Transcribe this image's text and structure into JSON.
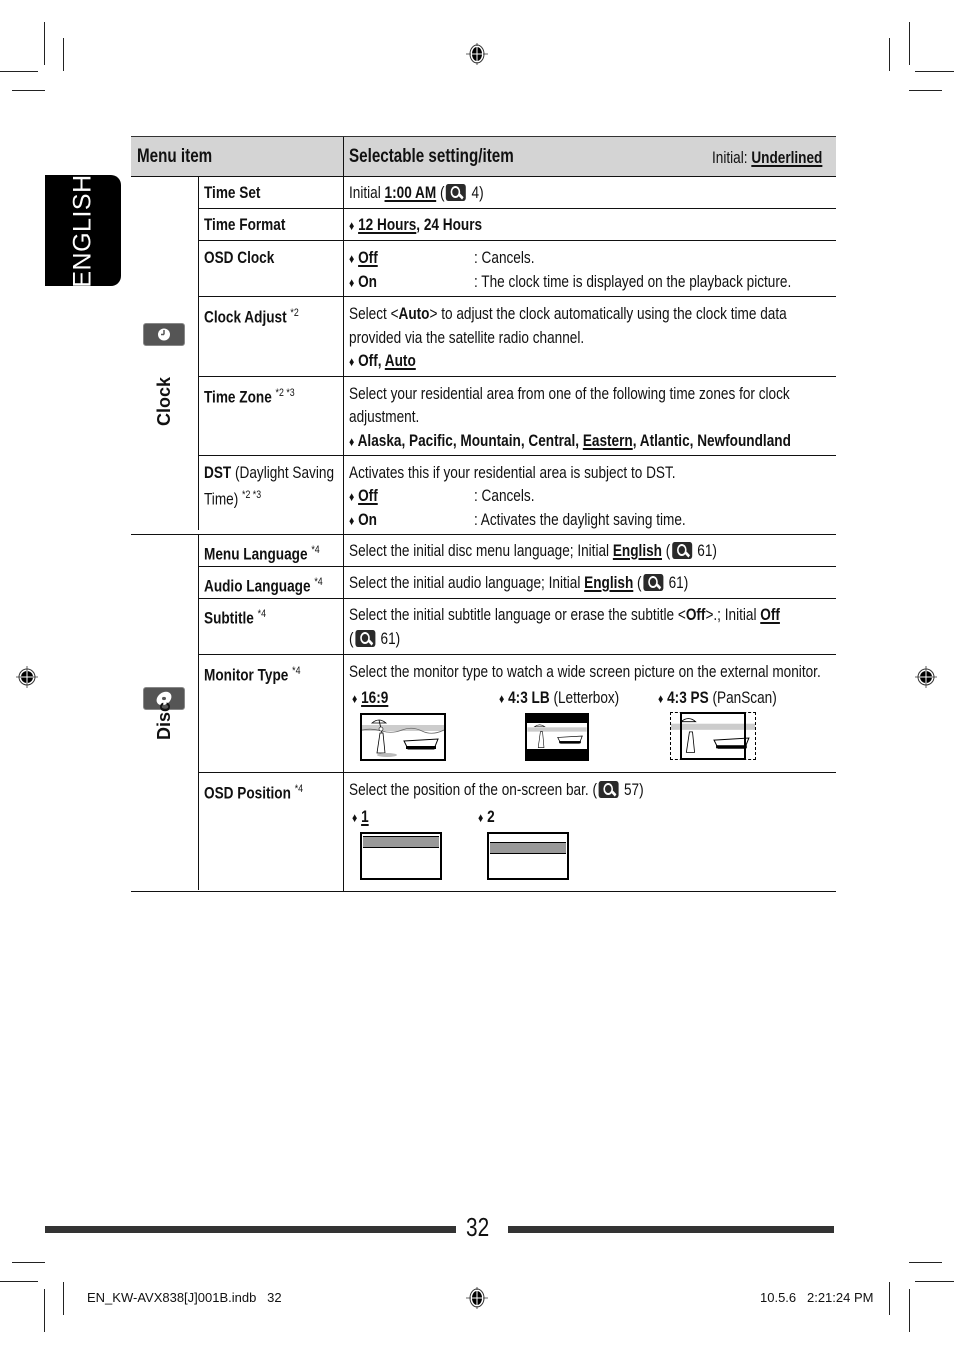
{
  "language_tab": "ENGLISH",
  "header": {
    "menu_item": "Menu item",
    "selectable": "Selectable setting/item",
    "initial_label": "Initial:",
    "initial_value": "Underlined"
  },
  "categories": {
    "clock": "Clock",
    "disc": "Disc"
  },
  "rows": {
    "time_set": {
      "name": "Time Set",
      "prefix": "Initial",
      "value": "1:00 AM",
      "ref_open": "(",
      "ref_page": "4)"
    },
    "time_format": {
      "name": "Time Format",
      "opt1": "12 Hours",
      "opt_rest": ", 24 Hours"
    },
    "osd_clock": {
      "name": "OSD Clock",
      "opt1": "Off",
      "desc1": ":  Cancels.",
      "opt2": "On",
      "desc2": ":  The clock time is displayed on the playback picture."
    },
    "clock_adjust": {
      "name": "Clock Adjust",
      "sup": "*2",
      "line1_a": "Select <",
      "line1_b": "Auto",
      "line1_c": "> to adjust the clock automatically using the clock time data",
      "line2": "provided via the satellite radio channel.",
      "opt1": "Off, ",
      "opt2": "Auto"
    },
    "time_zone": {
      "name": "Time Zone",
      "sup": "*2 *3",
      "line1": "Select your residential area from one of the following time zones for clock",
      "line2": "adjustment.",
      "opts_a": "Alaska, Pacific, Mountain, Central, ",
      "opts_u": "Eastern",
      "opts_b": ", Atlantic, Newfoundland"
    },
    "dst": {
      "name_b": "DST",
      "name_rest": " (Daylight Saving",
      "name_line2": "Time)",
      "sup": "*2 *3",
      "line1": "Activates this if your residential area is subject to DST.",
      "opt1": "Off",
      "desc1": ":  Cancels.",
      "opt2": "On",
      "desc2": ":  Activates the daylight saving time."
    },
    "menu_language": {
      "name": "Menu Language",
      "sup": "*4",
      "text": "Select the initial disc menu language; Initial ",
      "value": "English",
      "ref_open": " (",
      "ref_page": "61)"
    },
    "audio_language": {
      "name": "Audio Language",
      "sup": "*4",
      "text": "Select the initial audio language; Initial ",
      "value": "English",
      "ref_open": " (",
      "ref_page": "61)"
    },
    "subtitle": {
      "name": "Subtitle",
      "sup": "*4",
      "text_a": "Select the initial subtitle language or erase the subtitle <",
      "text_b": "Off",
      "text_c": ">.; Initial ",
      "value": "Off",
      "ref_open": "(",
      "ref_page": "61)"
    },
    "monitor_type": {
      "name": "Monitor Type",
      "sup": "*4",
      "text": "Select the monitor type to watch a wide screen picture on the external monitor.",
      "opt1": "16:9",
      "opt2": "4:3 LB",
      "opt2_note": " (Letterbox)",
      "opt3": "4:3 PS",
      "opt3_note": " (PanScan)"
    },
    "osd_position": {
      "name": "OSD Position",
      "sup": "*4",
      "text": "Select the position of the on-screen bar. (",
      "ref_page": "57)",
      "opt1": "1",
      "opt2": "2"
    }
  },
  "diamond": "♦",
  "footer": {
    "page_number": "32",
    "file": "EN_KW-AVX838[J]001B.indb   32",
    "timestamp": "10.5.6   2:21:24 PM"
  }
}
